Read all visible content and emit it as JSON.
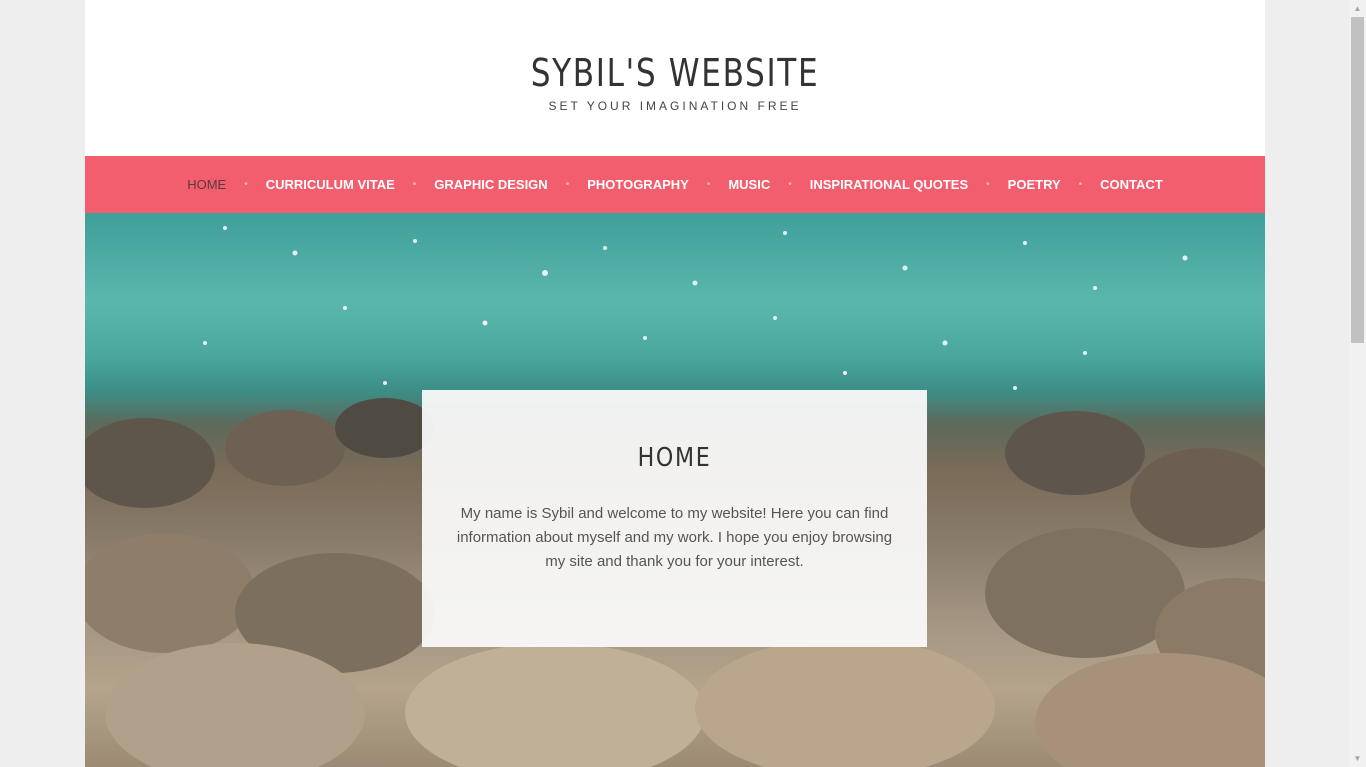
{
  "site": {
    "title": "SYBIL'S WEBSITE",
    "tagline": "SET YOUR IMAGINATION FREE"
  },
  "nav": {
    "items": [
      {
        "label": "HOME",
        "active": true
      },
      {
        "label": "CURRICULUM VITAE",
        "active": false
      },
      {
        "label": "GRAPHIC DESIGN",
        "active": false
      },
      {
        "label": "PHOTOGRAPHY",
        "active": false
      },
      {
        "label": "MUSIC",
        "active": false
      },
      {
        "label": "INSPIRATIONAL QUOTES",
        "active": false
      },
      {
        "label": "POETRY",
        "active": false
      },
      {
        "label": "CONTACT",
        "active": false
      }
    ],
    "separator": "•"
  },
  "content": {
    "title": "HOME",
    "text": "My name is Sybil and welcome to my website! Here you can find information about myself and my work. I hope you enjoy browsing my site and thank you for your interest."
  },
  "scrollbar": {
    "up_arrow": "▲",
    "down_arrow": "▼"
  },
  "colors": {
    "nav_background": "#f35e6e",
    "nav_active_text": "#5a3a3e",
    "page_background": "#eeeeee"
  },
  "hero_image": "sea-and-rocks-photo"
}
